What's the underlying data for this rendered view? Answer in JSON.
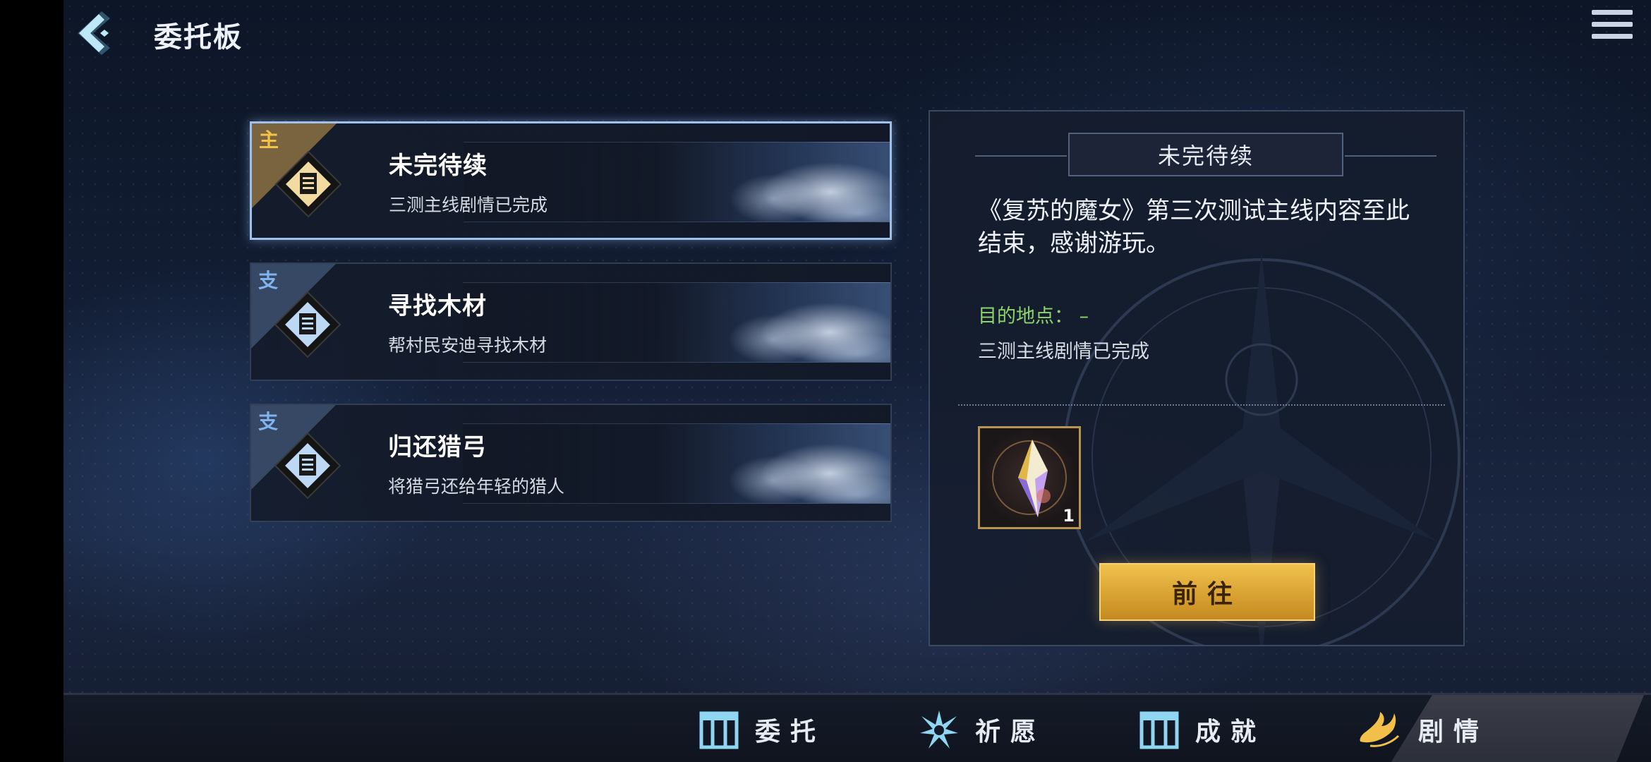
{
  "header": {
    "title": "委托板",
    "back_icon": "chevron-left-icon",
    "menu_icon": "hamburger-menu-icon"
  },
  "quests": [
    {
      "tag": "主",
      "type": "main",
      "title": "未完待续",
      "desc": "三测主线剧情已完成",
      "selected": true
    },
    {
      "tag": "支",
      "type": "side",
      "title": "寻找木材",
      "desc": "帮村民安迪寻找木材",
      "selected": false
    },
    {
      "tag": "支",
      "type": "side",
      "title": "归还猎弓",
      "desc": "将猎弓还给年轻的猎人",
      "selected": false
    }
  ],
  "detail": {
    "heading": "未完待续",
    "text": "《复苏的魔女》第三次测试主线内容至此结束，感谢游玩。",
    "destination_label": "目的地点：  –",
    "destination_sub": "三测主线剧情已完成",
    "reward_icon": "crystal-icon",
    "reward_count": "1",
    "go_button": "前往"
  },
  "bottom_nav": [
    {
      "label": "委托",
      "icon": "gate-icon",
      "active": false
    },
    {
      "label": "祈愿",
      "icon": "star-burst-icon",
      "active": false
    },
    {
      "label": "成就",
      "icon": "gate-icon",
      "active": false
    },
    {
      "label": "剧情",
      "icon": "flame-icon",
      "active": true
    }
  ],
  "colors": {
    "main_tag": "#f2c24a",
    "side_tag": "#7fb4ef",
    "destination": "#8fd46a",
    "go_button": "#e0aa38",
    "selected_border": "#9fc0e8"
  }
}
